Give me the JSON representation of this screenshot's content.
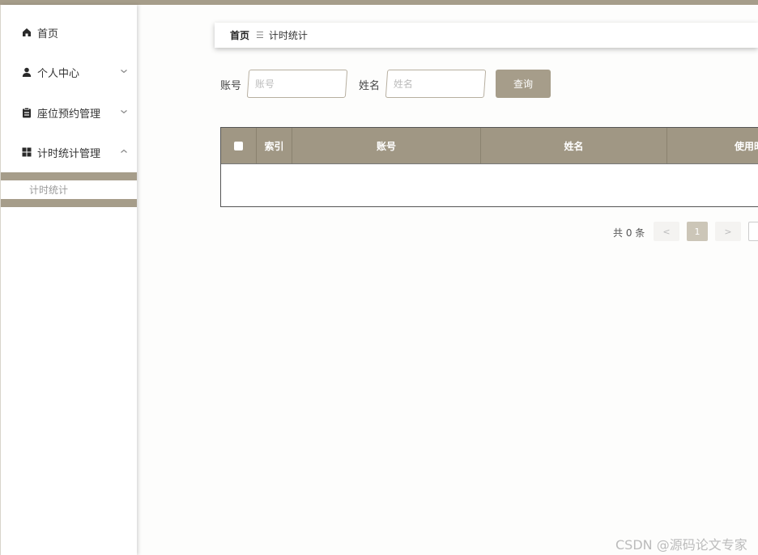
{
  "sidebar": {
    "items": [
      {
        "label": "首页",
        "icon": "home-icon"
      },
      {
        "label": "个人中心",
        "icon": "user-icon"
      },
      {
        "label": "座位预约管理",
        "icon": "clipboard-icon"
      },
      {
        "label": "计时统计管理",
        "icon": "grid-icon"
      }
    ],
    "sub_item": "计时统计"
  },
  "breadcrumb": {
    "home": "首页",
    "current": "计时统计"
  },
  "search": {
    "account_label": "账号",
    "account_placeholder": "账号",
    "name_label": "姓名",
    "name_placeholder": "姓名",
    "button": "查询"
  },
  "table": {
    "columns": [
      "索引",
      "账号",
      "姓名",
      "使用时"
    ]
  },
  "pagination": {
    "total": "共 0 条",
    "prev": "<",
    "page": "1",
    "next": ">"
  },
  "watermark": "CSDN @源码论文专家",
  "colors": {
    "accent": "#a69d8a",
    "header": "#a09784"
  }
}
